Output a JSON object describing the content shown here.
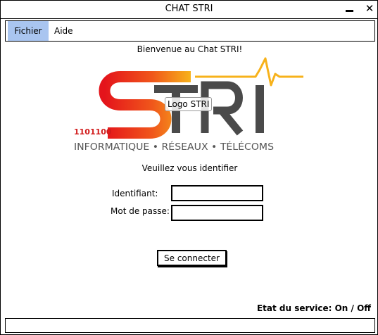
{
  "window": {
    "title": "CHAT STRI",
    "minimize_glyph": "–",
    "close_glyph": "✕"
  },
  "menu": {
    "items": [
      {
        "label": "Fichier",
        "active": true
      },
      {
        "label": "Aide",
        "active": false
      }
    ],
    "active_color": "#a9c5f0"
  },
  "welcome": "Bienvenue au Chat STRI!",
  "logo": {
    "alt_label": "Logo STRI",
    "wordmark": "STRI",
    "binary": "1101100",
    "tagline": "INFORMATIQUE • RÉSEAUX • TÉLÉCOMS",
    "colors": {
      "gradient_start": "#e4141b",
      "gradient_end": "#f7b21b",
      "letters": "#4a4a4a",
      "binary": "#d11a1a",
      "tagline": "#555555"
    }
  },
  "login": {
    "prompt": "Veuillez vous identifier",
    "identifiant_label": "Identifiant:",
    "identifiant_value": "",
    "password_label": "Mot de passe:",
    "password_value": "",
    "submit_label": "Se connecter"
  },
  "status": {
    "text": "Etat du service: On / Off"
  }
}
